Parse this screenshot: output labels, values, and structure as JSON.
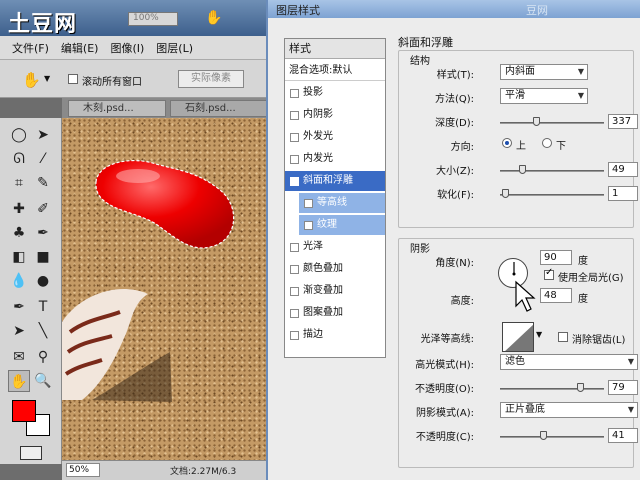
{
  "watermark": {
    "logo": "土豆网",
    "ghost_title": "豆网"
  },
  "ps": {
    "zoom_top": "100%",
    "menu": [
      "文件(F)",
      "编辑(E)",
      "图像(I)",
      "图层(L)"
    ],
    "options": {
      "scroll_all_label": "滚动所有窗口",
      "actual_pixels": "实际像素"
    },
    "tabs": [
      "木刻.psd...",
      "石刻.psd..."
    ],
    "status": {
      "zoom": "50%",
      "doc": "文档:2.27M/6.3"
    },
    "colors": {
      "foreground": "#ff0000",
      "background": "#ffffff"
    }
  },
  "dialog": {
    "title": "图层样式",
    "style_list": {
      "header": "样式",
      "blend": "混合选项:默认",
      "items": [
        {
          "label": "投影",
          "checked": false
        },
        {
          "label": "内阴影",
          "checked": false
        },
        {
          "label": "外发光",
          "checked": false
        },
        {
          "label": "内发光",
          "checked": false
        },
        {
          "label": "斜面和浮雕",
          "checked": true
        },
        {
          "label": "等高线",
          "checked": false
        },
        {
          "label": "纹理",
          "checked": false
        },
        {
          "label": "光泽",
          "checked": false
        },
        {
          "label": "颜色叠加",
          "checked": false
        },
        {
          "label": "渐变叠加",
          "checked": false
        },
        {
          "label": "图案叠加",
          "checked": false
        },
        {
          "label": "描边",
          "checked": false
        }
      ]
    },
    "bevel": {
      "title": "斜面和浮雕",
      "structure": {
        "label": "结构",
        "style_label": "样式(T):",
        "style_value": "内斜面",
        "method_label": "方法(Q):",
        "method_value": "平滑",
        "depth_label": "深度(D):",
        "depth_value": "337",
        "depth_level": 0.34,
        "direction_label": "方向:",
        "dir_up": "上",
        "dir_down": "下",
        "direction": "up",
        "size_label": "大小(Z):",
        "size_value": "49",
        "size_level": 0.2,
        "soften_label": "软化(F):",
        "soften_value": "1",
        "soften_level": 0.02
      },
      "shading": {
        "label": "阴影",
        "angle_label": "角度(N):",
        "angle_value": "90",
        "angle_unit": "度",
        "global_light_label": "使用全局光(G)",
        "global_light": true,
        "altitude_label": "高度:",
        "altitude_value": "48",
        "altitude_unit": "度",
        "gloss_label": "光泽等高线:",
        "anti_alias_label": "消除锯齿(L)",
        "anti_alias": false,
        "highlight_mode_label": "高光模式(H):",
        "highlight_mode": "滤色",
        "highlight_opacity_label": "不透明度(O):",
        "highlight_opacity": "79",
        "highlight_level": 0.79,
        "shadow_mode_label": "阴影模式(A):",
        "shadow_mode": "正片叠底",
        "shadow_opacity_label": "不透明度(C):",
        "shadow_opacity": "41",
        "shadow_level": 0.41
      }
    }
  }
}
